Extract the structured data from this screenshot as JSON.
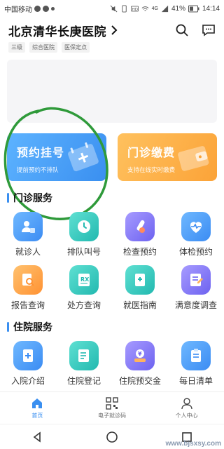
{
  "status_bar": {
    "carrier": "中国移动",
    "signal": "4G",
    "battery": "41%",
    "time": "14:14"
  },
  "header": {
    "hospital_name": "北京清华长庚医院",
    "tags": [
      "三级",
      "综合医院",
      "医保定点"
    ]
  },
  "cards": {
    "appointment": {
      "title": "预约挂号",
      "subtitle": "提前预约不排队"
    },
    "payment": {
      "title": "门诊缴费",
      "subtitle": "支持在线实时缴费"
    }
  },
  "outpatient": {
    "title": "门诊服务",
    "items": [
      {
        "label": "就诊人",
        "icon": "user-card-icon",
        "color": "#3b8cf3"
      },
      {
        "label": "排队叫号",
        "icon": "clock-icon",
        "color": "#22b9b0"
      },
      {
        "label": "检查预约",
        "icon": "test-tube-icon",
        "color": "#6d62f0"
      },
      {
        "label": "体检预约",
        "icon": "heartbeat-icon",
        "color": "#3b8cf3"
      },
      {
        "label": "报告查询",
        "icon": "report-search-icon",
        "color": "#ff9233"
      },
      {
        "label": "处方查询",
        "icon": "prescription-icon",
        "color": "#22b9b0"
      },
      {
        "label": "就医指南",
        "icon": "guide-book-icon",
        "color": "#22b9b0"
      },
      {
        "label": "满意度调查",
        "icon": "survey-icon",
        "color": "#6d62f0"
      }
    ]
  },
  "inpatient": {
    "title": "住院服务",
    "items": [
      {
        "label": "入院介绍",
        "icon": "admission-icon",
        "color": "#3b8cf3"
      },
      {
        "label": "住院登记",
        "icon": "register-icon",
        "color": "#22b9b0"
      },
      {
        "label": "住院预交金",
        "icon": "deposit-icon",
        "color": "#6d62f0"
      },
      {
        "label": "每日清单",
        "icon": "daily-list-icon",
        "color": "#3b8cf3"
      }
    ]
  },
  "tabbar": {
    "items": [
      {
        "label": "首页",
        "icon": "home-icon",
        "active": true
      },
      {
        "label": "电子就诊码",
        "icon": "qr-code-icon",
        "active": false
      },
      {
        "label": "个人中心",
        "icon": "person-icon",
        "active": false
      }
    ]
  },
  "watermark": "www.bjsxsy.com"
}
